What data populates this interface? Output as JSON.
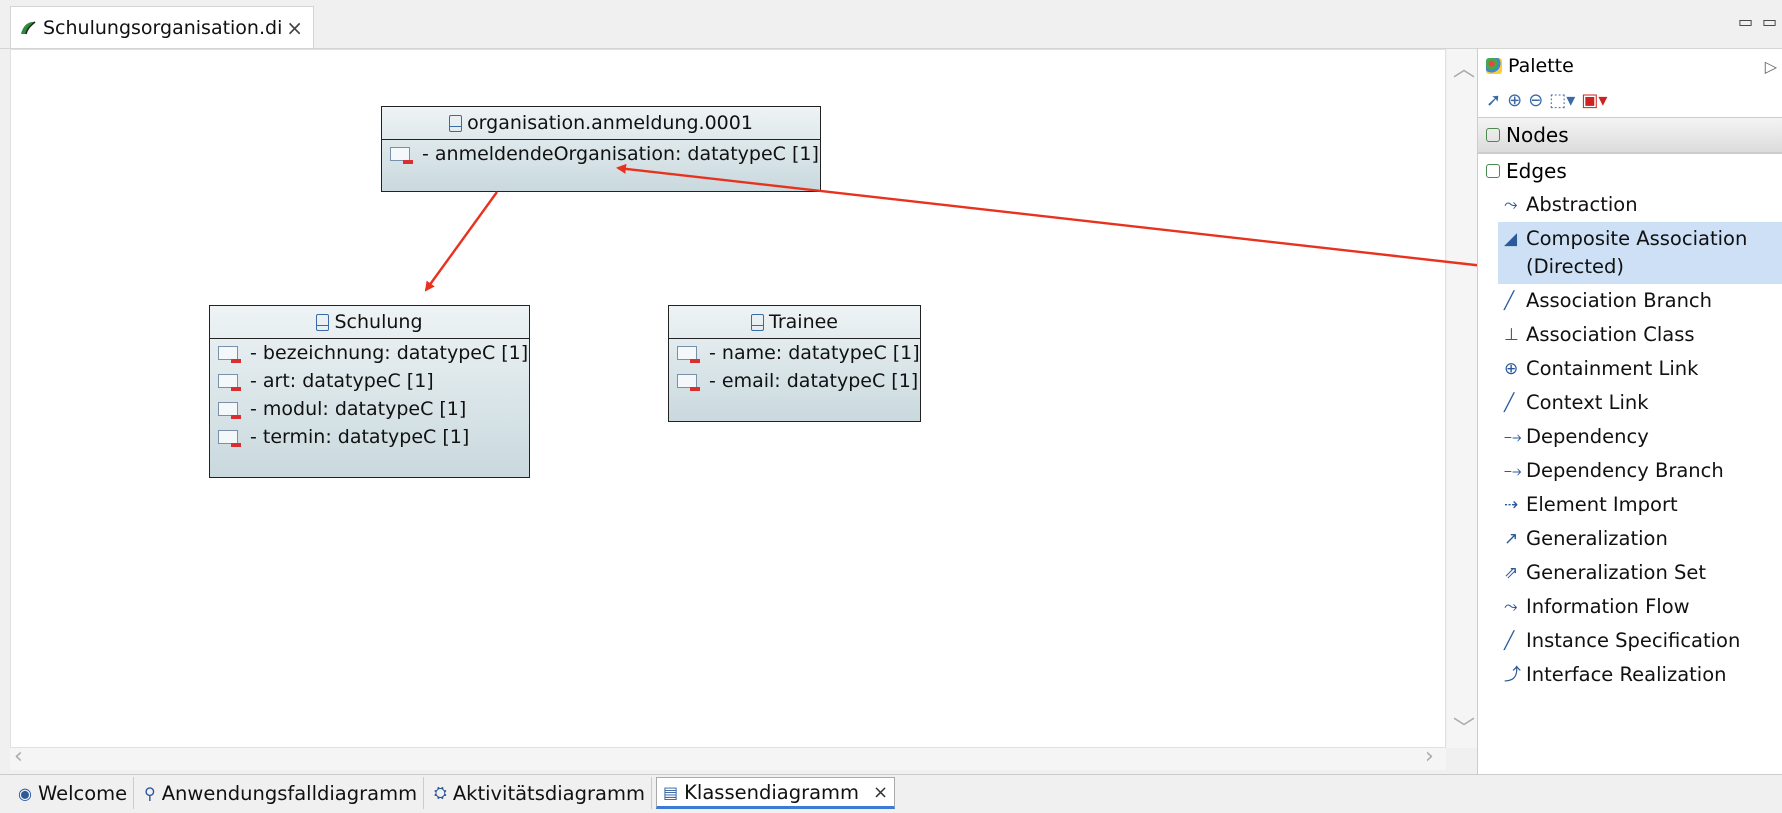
{
  "editor_tab": {
    "title": "Schulungsorganisation.di",
    "close": "×"
  },
  "window_controls": {
    "minimize": "▭",
    "maximize": "▭"
  },
  "diagram": {
    "classes": [
      {
        "name": "organisation.anmeldung.0001",
        "attributes": [
          "- anmeldendeOrganisation: datatypeC [1]"
        ]
      },
      {
        "name": "Schulung",
        "attributes": [
          "- bezeichnung: datatypeC [1]",
          "- art: datatypeC [1]",
          "- modul: datatypeC [1]",
          "- termin: datatypeC [1]"
        ]
      },
      {
        "name": "Trainee",
        "attributes": [
          "- name: datatypeC [1]",
          "- email: datatypeC [1]"
        ]
      }
    ],
    "annotation_arrow_color": "#e8321e"
  },
  "palette": {
    "title": "Palette",
    "drawers": {
      "nodes": "Nodes",
      "edges": "Edges"
    },
    "items": [
      {
        "label": "Abstraction",
        "icon": "abstraction-icon"
      },
      {
        "label": "Composite Association (Directed)",
        "icon": "composite-association-icon",
        "selected": true
      },
      {
        "label": "Association Branch",
        "icon": "association-branch-icon"
      },
      {
        "label": "Association Class",
        "icon": "association-class-icon"
      },
      {
        "label": "Containment Link",
        "icon": "containment-link-icon"
      },
      {
        "label": "Context Link",
        "icon": "context-link-icon"
      },
      {
        "label": "Dependency",
        "icon": "dependency-icon"
      },
      {
        "label": "Dependency Branch",
        "icon": "dependency-branch-icon"
      },
      {
        "label": "Element Import",
        "icon": "element-import-icon"
      },
      {
        "label": "Generalization",
        "icon": "generalization-icon"
      },
      {
        "label": "Generalization Set",
        "icon": "generalization-set-icon"
      },
      {
        "label": "Information Flow",
        "icon": "information-flow-icon"
      },
      {
        "label": "Instance Specification",
        "icon": "instance-specification-icon"
      },
      {
        "label": "Interface Realization",
        "icon": "interface-realization-icon"
      }
    ]
  },
  "bottom_tabs": [
    {
      "label": "Welcome"
    },
    {
      "label": "Anwendungsfalldiagramm"
    },
    {
      "label": "Aktivitätsdiagramm"
    },
    {
      "label": "Klassendiagramm",
      "active": true,
      "close": "×"
    }
  ]
}
